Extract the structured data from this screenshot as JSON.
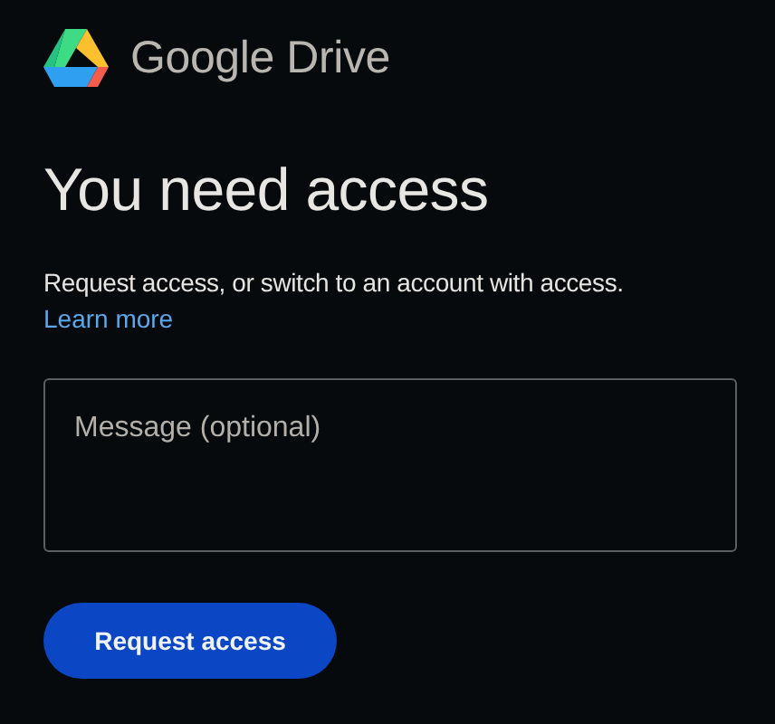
{
  "brand": {
    "name": "Google Drive"
  },
  "heading": "You need access",
  "description": "Request access, or switch to an account with access.",
  "link": "Learn more",
  "message_field": {
    "placeholder": "Message (optional)"
  },
  "button": "Request access"
}
